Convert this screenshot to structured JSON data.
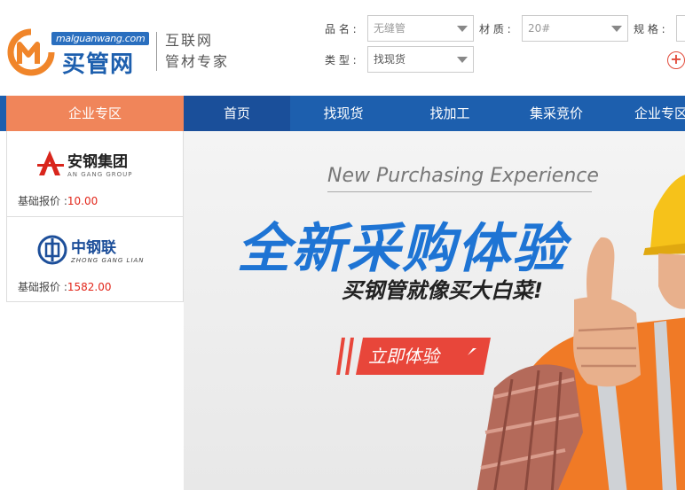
{
  "header": {
    "logo_domain": "malguanwang.com",
    "logo_name": "买管网",
    "slogan_line1": "互联网",
    "slogan_line2": "管材专家",
    "filters": {
      "product_label": "品 名 :",
      "product_value": "无缝管",
      "material_label": "材 质 :",
      "material_value": "20#",
      "spec_label": "规 格 :",
      "type_label": "类 型 :",
      "type_value": "找现货"
    }
  },
  "nav": {
    "side_label": "企业专区",
    "items": [
      "首页",
      "找现货",
      "找加工",
      "集采竞价",
      "企业专区"
    ]
  },
  "sidebar": {
    "companies": [
      {
        "name": "安钢集团",
        "sub": "AN GANG GROUP",
        "price_label": "基础报价 :",
        "price": "10.00"
      },
      {
        "name": "中钢联",
        "sub": "ZHONG GANG LIAN",
        "price_label": "基础报价 :",
        "price": "1582.00"
      }
    ]
  },
  "banner": {
    "english": "New Purchasing Experience",
    "headline": "全新采购体验",
    "subline": "买钢管就像买大白菜!",
    "cta": "立即体验"
  },
  "colors": {
    "brand_blue": "#1d5fae",
    "accent_orange": "#f0855a",
    "price_red": "#e2261a",
    "cta_red": "#e8463a"
  }
}
